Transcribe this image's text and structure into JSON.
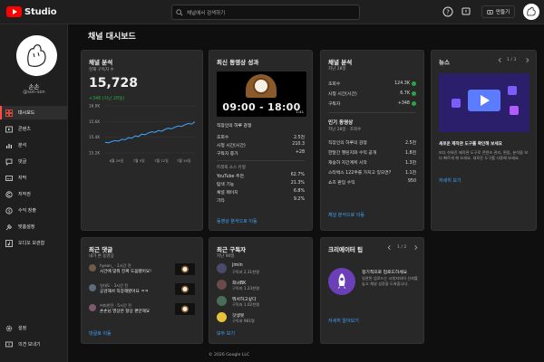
{
  "header": {
    "logo_text": "Studio",
    "search_placeholder": "채널에서 검색하기",
    "create_label": "만들기"
  },
  "sidebar": {
    "channel_name": "손손",
    "channel_handle": "@son-son",
    "items": [
      {
        "label": "대시보드",
        "icon": "dashboard-icon",
        "active": true
      },
      {
        "label": "콘텐츠",
        "icon": "content-icon"
      },
      {
        "label": "분석",
        "icon": "analytics-icon"
      },
      {
        "label": "댓글",
        "icon": "comments-icon"
      },
      {
        "label": "자막",
        "icon": "subtitles-icon"
      },
      {
        "label": "저작권",
        "icon": "copyright-icon"
      },
      {
        "label": "수익 창출",
        "icon": "monetization-icon"
      },
      {
        "label": "맞춤설정",
        "icon": "customization-icon"
      },
      {
        "label": "오디오 보관함",
        "icon": "audio-library-icon"
      }
    ],
    "bottom_items": [
      {
        "label": "설정",
        "icon": "settings-icon"
      },
      {
        "label": "의견 보내기",
        "icon": "feedback-icon"
      }
    ]
  },
  "page_title": "채널 대시보드",
  "analytics_card": {
    "title": "채널 분석",
    "subscribers_label": "현재 구독자 수",
    "subscribers_value": "15,728",
    "change": "+348 (지난 28일)",
    "accent_color": "#3ea6ff"
  },
  "chart_data": {
    "type": "line",
    "x_tick_labels": [
      "6월 29일",
      "7월 5일",
      "7월 12일",
      "7월 19일"
    ],
    "y_tick_labels": [
      "15.2K",
      "15.4K",
      "15.6K",
      "16.0K"
    ],
    "ylim": [
      15200,
      16000
    ],
    "series": [
      {
        "values": [
          15380,
          15372,
          15395,
          15410,
          15400,
          15430,
          15425,
          15460,
          15450,
          15490,
          15480,
          15520,
          15510,
          15540,
          15560,
          15550,
          15580,
          15570,
          15600,
          15620,
          15610,
          15640,
          15660,
          15650,
          15680,
          15700,
          15690,
          15728
        ]
      }
    ]
  },
  "latest_video": {
    "title": "최신 동영상 성과",
    "thumbnail_text": "09:00 - 18:00",
    "thumbnail_duration": "1:41",
    "video_title": "직장인의 하루 감정",
    "stats": [
      {
        "label": "조회수",
        "value": "2.5천"
      },
      {
        "label": "시청 시간(시간)",
        "value": "210.3"
      },
      {
        "label": "구독자 증가",
        "value": "+28"
      }
    ],
    "traffic_header": "트래픽 소스 유형",
    "traffic": [
      {
        "label": "YouTube 추천",
        "value": "62.7%"
      },
      {
        "label": "탐색 기능",
        "value": "21.3%"
      },
      {
        "label": "채널 페이지",
        "value": "6.8%"
      },
      {
        "label": "기타",
        "value": "9.2%"
      }
    ],
    "link": "동영상 분석으로 이동"
  },
  "channel_summary": {
    "title": "채널 분석",
    "period": "지난 28일",
    "stats": [
      {
        "label": "조회수",
        "value": "124.3K"
      },
      {
        "label": "시청 시간(시간)",
        "value": "6.7K"
      },
      {
        "label": "구독자",
        "value": "+348"
      }
    ],
    "popular_title": "인기 동영상",
    "popular_period": "지난 28일 · 조회수",
    "videos": [
      {
        "title": "직장인의 하루의 감정",
        "value": "2.5천"
      },
      {
        "title": "한달간 챌린지와 수익 공개",
        "value": "1.8천"
      },
      {
        "title": "재승하 지간계획 시작",
        "value": "1.3천"
      },
      {
        "title": "스타벅스 122주를 가지고 있으면?",
        "value": "1.1천"
      },
      {
        "title": "쇼츠 판입 수익",
        "value": "950"
      }
    ],
    "link": "채널 분석으로 이동"
  },
  "news": {
    "title": "뉴스",
    "pager": "1 / 3",
    "headline": "새로운 제작관 도구를 확인해 보세요",
    "body": "보다 쉬워진 제작관 도구로 콘텐츠 관리, 편집, 분석을 보다 빠르게 해 보세요. 새로운 도구를 사용해 보세요.",
    "link": "자세히 보기"
  },
  "comments": {
    "title": "최근 댓글",
    "subtitle": "내가 쓴 동영상",
    "items": [
      {
        "author": "hyeon_",
        "time": "1시간 전",
        "text": "시간에 맞춰 진짜 도움됐어요!"
      },
      {
        "author": "일대도",
        "time": "3시간 전",
        "text": "공감해서 직장해봤어요 ㅋㅋ"
      },
      {
        "author": "커피한잔",
        "time": "5시간 전",
        "text": "손손님 영상은 항상 편안해요"
      }
    ],
    "link": "댓글로 이동"
  },
  "subscribers": {
    "title": "최근 구독자",
    "period": "지난 90일",
    "items": [
      {
        "name": "jimin",
        "count": "구독자 2.31천명"
      },
      {
        "name": "희녀BK",
        "count": "구독자 1.23천명"
      },
      {
        "name": "뭐서하고싶다",
        "count": "구독자 1.02천명"
      },
      {
        "name": "갓생봇",
        "count": "구독자 981명"
      }
    ],
    "link": "모두 보기"
  },
  "tips": {
    "title": "크리에이터 팁",
    "pager": "1 / 2",
    "tip_title": "정기적으로 업로드하세요",
    "tip_body": "일관된 업로드는 시청자와의 신뢰를 높고 채널 성장을 도와줍니다.",
    "link": "자세히 알아보기"
  },
  "footer": "© 2026 Google LLC"
}
